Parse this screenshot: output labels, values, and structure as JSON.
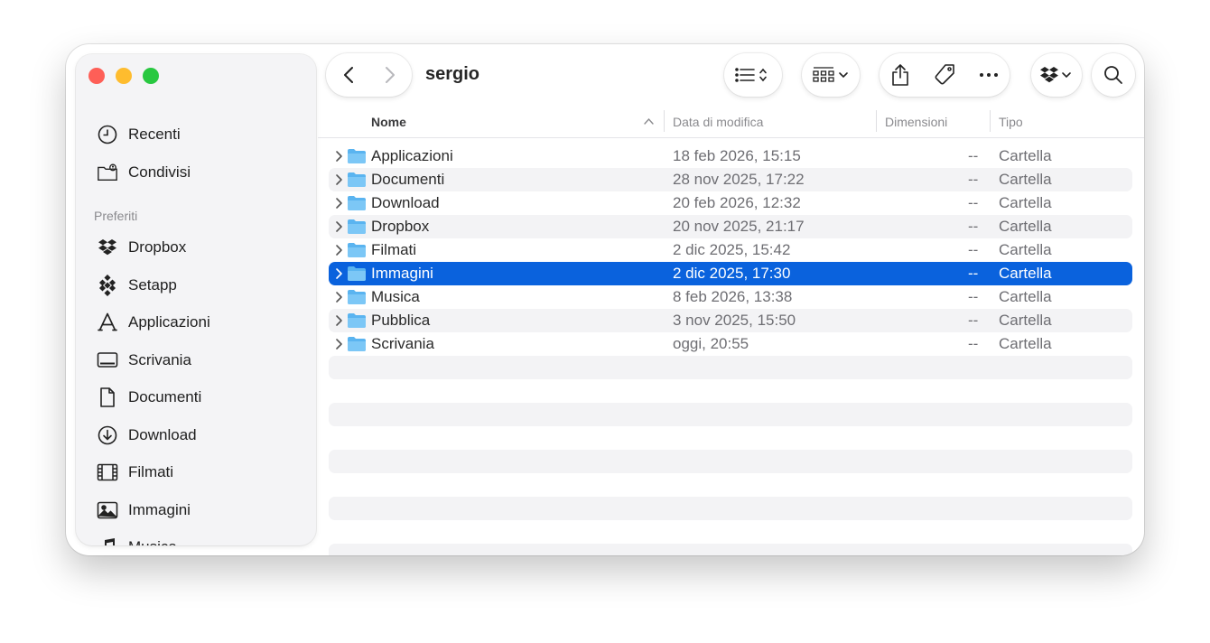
{
  "window": {
    "title": "sergio"
  },
  "sidebar": {
    "top_items": [
      {
        "label": "Recenti",
        "icon": "clock-icon"
      },
      {
        "label": "Condivisi",
        "icon": "shared-folder-icon"
      }
    ],
    "section_title": "Preferiti",
    "favorites": [
      {
        "label": "Dropbox",
        "icon": "dropbox-icon"
      },
      {
        "label": "Setapp",
        "icon": "setapp-icon"
      },
      {
        "label": "Applicazioni",
        "icon": "applications-icon"
      },
      {
        "label": "Scrivania",
        "icon": "desktop-icon"
      },
      {
        "label": "Documenti",
        "icon": "document-icon"
      },
      {
        "label": "Download",
        "icon": "download-icon"
      },
      {
        "label": "Filmati",
        "icon": "film-icon"
      },
      {
        "label": "Immagini",
        "icon": "photo-icon"
      },
      {
        "label": "Musica",
        "icon": "music-note-icon"
      }
    ]
  },
  "columns": {
    "name": "Nome",
    "date": "Data di modifica",
    "size": "Dimensioni",
    "kind": "Tipo"
  },
  "files": [
    {
      "name": "Applicazioni",
      "date": "18 feb 2026, 15:15",
      "size": "--",
      "kind": "Cartella"
    },
    {
      "name": "Documenti",
      "date": "28 nov 2025, 17:22",
      "size": "--",
      "kind": "Cartella"
    },
    {
      "name": "Download",
      "date": "20 feb 2026, 12:32",
      "size": "--",
      "kind": "Cartella"
    },
    {
      "name": "Dropbox",
      "date": "20 nov 2025, 21:17",
      "size": "--",
      "kind": "Cartella"
    },
    {
      "name": "Filmati",
      "date": "2 dic 2025, 15:42",
      "size": "--",
      "kind": "Cartella"
    },
    {
      "name": "Immagini",
      "date": "2 dic 2025, 17:30",
      "size": "--",
      "kind": "Cartella",
      "selected": true
    },
    {
      "name": "Musica",
      "date": "8 feb 2026, 13:38",
      "size": "--",
      "kind": "Cartella"
    },
    {
      "name": "Pubblica",
      "date": "3 nov 2025, 15:50",
      "size": "--",
      "kind": "Cartella"
    },
    {
      "name": "Scrivania",
      "date": "oggi, 20:55",
      "size": "--",
      "kind": "Cartella"
    }
  ],
  "colors": {
    "selection": "#0a62dd",
    "folder": "#5ab4f0",
    "close": "#fe5f57",
    "minimize": "#febc2e",
    "zoom": "#28c840"
  }
}
